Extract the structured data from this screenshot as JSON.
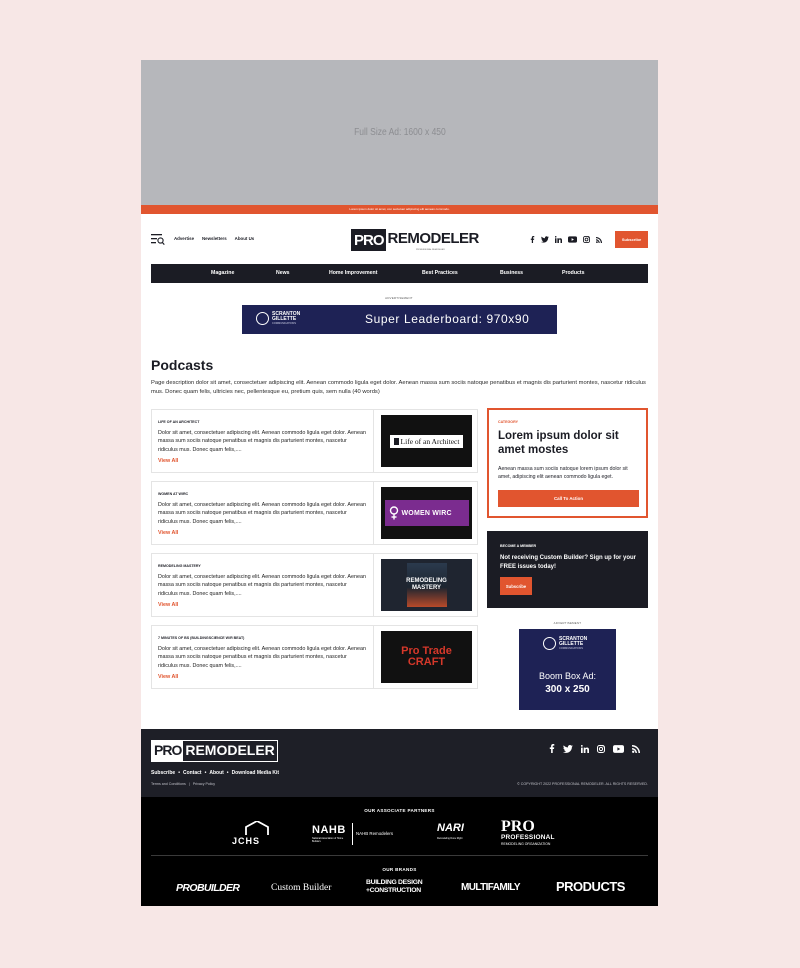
{
  "top_ad": {
    "text": "Full Size Ad: 1600 x 450"
  },
  "promo_bar": {
    "text": "Lorem ipsum dolor sit amet, con sectetuer adipiscing elit aenean commodo."
  },
  "header": {
    "links": [
      "Advertise",
      "Newsletters",
      "About Us"
    ],
    "logo": {
      "pro": "PRO",
      "rest": "REMODELER",
      "tagline": "PROFESSIONAL REMODELER"
    },
    "subscribe_label": "Subscribe",
    "social_icons": [
      "facebook-icon",
      "twitter-icon",
      "linkedin-icon",
      "youtube-icon",
      "instagram-icon",
      "rss-icon"
    ]
  },
  "nav": {
    "items": [
      "Magazine",
      "News",
      "Home Improvement",
      "Best Practices",
      "Business",
      "Products"
    ]
  },
  "leaderboard": {
    "label": "ADVERTISEMENT",
    "brand": [
      "SCRANTON",
      "GILLETTE"
    ],
    "brand_sub": "COMMUNICATIONS",
    "text": "Super Leaderboard: 970x90"
  },
  "page": {
    "title": "Podcasts",
    "description": "Page description dolor sit amet, consectetuer adipiscing elit. Aenean commodo ligula eget dolor. Aenean massa sum sociis natoque penatibus et magnis dis parturient montes, nascetur ridiculus mus. Donec quam felis, ultricies nec, pellentesque eu, pretium quis, sem nulla  (40 words)"
  },
  "podcasts": [
    {
      "category": "LIFE OF AN ARCHITECT",
      "body": "Dolor sit amet, consectetuer adipiscing elit. Aenean commodo ligula eget dolor. Aenean massa sum sociis natoque penatibus et magnis dis parturient montes, nascetur ridiculus mus. Donec quam felis,....",
      "more": "View All",
      "thumb": "Life of an Architect"
    },
    {
      "category": "WOMEN AT WIRC",
      "body": "Dolor sit amet, consectetuer adipiscing elit. Aenean commodo ligula eget dolor. Aenean massa sum sociis natoque penatibus et magnis dis parturient montes, nascetur ridiculus mus. Donec quam felis,....",
      "more": "View All",
      "thumb": "WOMEN WIRC"
    },
    {
      "category": "REMODELING MASTERY",
      "body": "Dolor sit amet, consectetuer adipiscing elit. Aenean commodo ligula eget dolor. Aenean massa sum sociis natoque penatibus et magnis dis parturient montes, nascetur ridiculus mus. Donec quam felis,....",
      "more": "View All",
      "thumb": "REMODELING MASTERY"
    },
    {
      "category": "7 MINUTES OF BS (BUILDINGSCIENCE W/R BEAT)",
      "body": "Dolor sit amet, consectetuer adipiscing elit. Aenean commodo ligula eget dolor. Aenean massa sum sociis natoque penatibus et magnis dis parturient montes, nascetur ridiculus mus. Donec quam felis,....",
      "more": "View All",
      "thumb": "Pro Trade CRAFT"
    }
  ],
  "cta": {
    "category": "CATEGORY",
    "headline": "Lorem ipsum dolor sit amet mostes",
    "body": "Aenean massa sum sociis natoque lorem ipsum dolor sit amet, adipiscing elit aenean commodo ligula eget.",
    "button": "Call To Action"
  },
  "member": {
    "label": "BECOME A MEMBER",
    "text": "Not receiving Custom Builder?  Sign up for your FREE issues today!",
    "button": "Subscribe"
  },
  "boombox": {
    "label": "ADVERTISEMENT",
    "brand": [
      "SCRANTON",
      "GILLETTE"
    ],
    "brand_sub": "COMMUNICATIONS",
    "line1": "Boom Box Ad:",
    "line2": "300 x 250"
  },
  "footer": {
    "logo": {
      "pro": "PRO",
      "rest": "REMODELER"
    },
    "links": [
      "Subscribe",
      "Contact",
      "About",
      "Download Media Kit"
    ],
    "legal": [
      "Terms and Conditions",
      "Privacy Policy"
    ],
    "copyright": "© COPYRIGHT 2022 PROFESSIONAL REMODELER. ALL RIGHTS RESERVED."
  },
  "partners": {
    "heading": "OUR ASSOCIATE PARTNERS",
    "jchs": "JCHS",
    "nahb": "NAHB",
    "nahb_sub": "National Association of Home Builders",
    "nahb_side": "NAHB Remodelers",
    "nari": "NARI",
    "nari_sub": "Remodeling Done Right",
    "pro": "PRO",
    "pro_line1": "PROFESSIONAL",
    "pro_line2": "REMODELING ORGANIZATION"
  },
  "brands": {
    "heading": "OUR BRANDS",
    "items": [
      "PROBUILDER",
      "Custom Builder",
      "BUILDING DESIGN +CONSTRUCTION",
      "MULTIFAMILY",
      "PRODUCTS"
    ]
  },
  "colors": {
    "accent": "#e1552f",
    "dark": "#1b1c24",
    "ad_navy": "#1e2255"
  }
}
